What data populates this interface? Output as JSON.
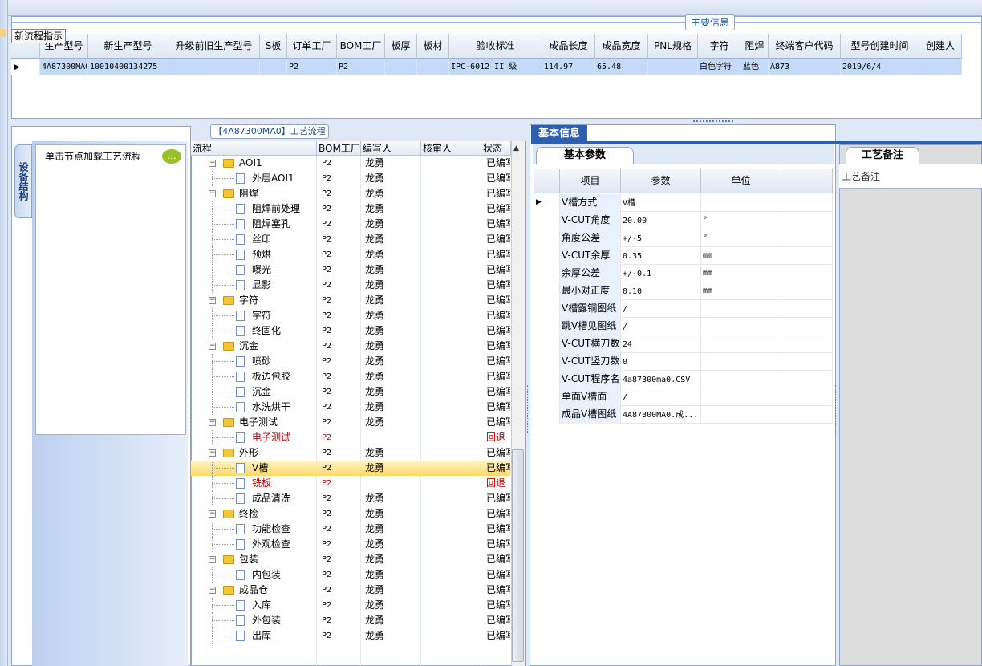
{
  "main_panel": {
    "group_title": "主要信息",
    "hint_label": "新流程指示",
    "columns": [
      "生产型号",
      "新生产型号",
      "升级前旧生产型号",
      "S板",
      "订单工厂",
      "BOM工厂",
      "板厚",
      "板材",
      "验收标准",
      "成品长度",
      "成品宽度",
      "PNL规格",
      "字符",
      "阻焊",
      "终端客户代码",
      "型号创建时间",
      "创建人"
    ],
    "row": [
      "4A87300MA0",
      "10010400134275",
      "",
      "",
      "P2",
      "P2",
      "",
      "",
      "IPC-6012 II 级",
      "114.97",
      "65.48",
      "",
      "白色字符",
      "蓝色",
      "A873",
      "2019/6/4",
      ""
    ]
  },
  "left_panel": {
    "vertical_tab": "设备结构",
    "node_hint": "单击节点加载工艺流程"
  },
  "process_panel": {
    "title": "【4A87300MA0】工艺流程",
    "columns": [
      "流程",
      "BOM工厂",
      "编写人",
      "核审人",
      "状态"
    ],
    "rows": [
      {
        "level": 1,
        "type": "folder",
        "name": "AOI1",
        "bom": "P2",
        "author": "龙勇",
        "status": "已编写",
        "red": false,
        "selected": false
      },
      {
        "level": 2,
        "type": "doc",
        "name": "外层AOI1",
        "bom": "P2",
        "author": "龙勇",
        "status": "已编写",
        "red": false,
        "selected": false
      },
      {
        "level": 1,
        "type": "folder",
        "name": "阻焊",
        "bom": "P2",
        "author": "龙勇",
        "status": "已编写",
        "red": false,
        "selected": false
      },
      {
        "level": 2,
        "type": "doc",
        "name": "阻焊前处理",
        "bom": "P2",
        "author": "龙勇",
        "status": "已编写",
        "red": false,
        "selected": false
      },
      {
        "level": 2,
        "type": "doc",
        "name": "阻焊塞孔",
        "bom": "P2",
        "author": "龙勇",
        "status": "已编写",
        "red": false,
        "selected": false
      },
      {
        "level": 2,
        "type": "doc",
        "name": "丝印",
        "bom": "P2",
        "author": "龙勇",
        "status": "已编写",
        "red": false,
        "selected": false
      },
      {
        "level": 2,
        "type": "doc",
        "name": "预烘",
        "bom": "P2",
        "author": "龙勇",
        "status": "已编写",
        "red": false,
        "selected": false
      },
      {
        "level": 2,
        "type": "doc",
        "name": "曝光",
        "bom": "P2",
        "author": "龙勇",
        "status": "已编写",
        "red": false,
        "selected": false
      },
      {
        "level": 2,
        "type": "doc",
        "name": "显影",
        "bom": "P2",
        "author": "龙勇",
        "status": "已编写",
        "red": false,
        "selected": false
      },
      {
        "level": 1,
        "type": "folder",
        "name": "字符",
        "bom": "P2",
        "author": "龙勇",
        "status": "已编写",
        "red": false,
        "selected": false
      },
      {
        "level": 2,
        "type": "doc",
        "name": "字符",
        "bom": "P2",
        "author": "龙勇",
        "status": "已编写",
        "red": false,
        "selected": false
      },
      {
        "level": 2,
        "type": "doc",
        "name": "终固化",
        "bom": "P2",
        "author": "龙勇",
        "status": "已编写",
        "red": false,
        "selected": false
      },
      {
        "level": 1,
        "type": "folder",
        "name": "沉金",
        "bom": "P2",
        "author": "龙勇",
        "status": "已编写",
        "red": false,
        "selected": false
      },
      {
        "level": 2,
        "type": "doc",
        "name": "喷砂",
        "bom": "P2",
        "author": "龙勇",
        "status": "已编写",
        "red": false,
        "selected": false
      },
      {
        "level": 2,
        "type": "doc",
        "name": "板边包胶",
        "bom": "P2",
        "author": "龙勇",
        "status": "已编写",
        "red": false,
        "selected": false
      },
      {
        "level": 2,
        "type": "doc",
        "name": "沉金",
        "bom": "P2",
        "author": "龙勇",
        "status": "已编写",
        "red": false,
        "selected": false
      },
      {
        "level": 2,
        "type": "doc",
        "name": "水洗烘干",
        "bom": "P2",
        "author": "龙勇",
        "status": "已编写",
        "red": false,
        "selected": false
      },
      {
        "level": 1,
        "type": "folder",
        "name": "电子测试",
        "bom": "P2",
        "author": "龙勇",
        "status": "已编写",
        "red": false,
        "selected": false
      },
      {
        "level": 2,
        "type": "doc",
        "name": "电子测试",
        "bom": "P2",
        "author": "",
        "status": "回退",
        "red": true,
        "selected": false
      },
      {
        "level": 1,
        "type": "folder",
        "name": "外形",
        "bom": "P2",
        "author": "龙勇",
        "status": "已编写",
        "red": false,
        "selected": false
      },
      {
        "level": 2,
        "type": "doc",
        "name": "V槽",
        "bom": "P2",
        "author": "龙勇",
        "status": "已编写",
        "red": false,
        "selected": true
      },
      {
        "level": 2,
        "type": "doc",
        "name": "铣板",
        "bom": "P2",
        "author": "",
        "status": "回退",
        "red": true,
        "selected": false
      },
      {
        "level": 2,
        "type": "doc",
        "name": "成品清洗",
        "bom": "P2",
        "author": "龙勇",
        "status": "已编写",
        "red": false,
        "selected": false
      },
      {
        "level": 1,
        "type": "folder",
        "name": "终检",
        "bom": "P2",
        "author": "龙勇",
        "status": "已编写",
        "red": false,
        "selected": false
      },
      {
        "level": 2,
        "type": "doc",
        "name": "功能检查",
        "bom": "P2",
        "author": "龙勇",
        "status": "已编写",
        "red": false,
        "selected": false
      },
      {
        "level": 2,
        "type": "doc",
        "name": "外观检查",
        "bom": "P2",
        "author": "龙勇",
        "status": "已编写",
        "red": false,
        "selected": false
      },
      {
        "level": 1,
        "type": "folder",
        "name": "包装",
        "bom": "P2",
        "author": "龙勇",
        "status": "已编写",
        "red": false,
        "selected": false
      },
      {
        "level": 2,
        "type": "doc",
        "name": "内包装",
        "bom": "P2",
        "author": "龙勇",
        "status": "已编写",
        "red": false,
        "selected": false
      },
      {
        "level": 1,
        "type": "folder",
        "name": "成品仓",
        "bom": "P2",
        "author": "龙勇",
        "status": "已编写",
        "red": false,
        "selected": false
      },
      {
        "level": 2,
        "type": "doc",
        "name": "入库",
        "bom": "P2",
        "author": "龙勇",
        "status": "已编写",
        "red": false,
        "selected": false
      },
      {
        "level": 2,
        "type": "doc",
        "name": "外包装",
        "bom": "P2",
        "author": "龙勇",
        "status": "已编写",
        "red": false,
        "selected": false
      },
      {
        "level": 2,
        "type": "doc",
        "name": "出库",
        "bom": "P2",
        "author": "龙勇",
        "status": "已编写",
        "red": false,
        "selected": false
      }
    ]
  },
  "basic_info": {
    "tab": "基本信息",
    "subtab": "基本参数",
    "columns": [
      "项目",
      "参数",
      "单位"
    ],
    "rows": [
      {
        "item": "V槽方式",
        "value": "V槽",
        "unit": ""
      },
      {
        "item": "V-CUT角度",
        "value": "20.00",
        "unit": "°"
      },
      {
        "item": "角度公差",
        "value": "+/-5",
        "unit": "°"
      },
      {
        "item": "V-CUT余厚",
        "value": "0.35",
        "unit": "mm"
      },
      {
        "item": "余厚公差",
        "value": "+/-0.1",
        "unit": "mm"
      },
      {
        "item": "最小对正度",
        "value": "0.10",
        "unit": "mm"
      },
      {
        "item": "V槽露铜图纸",
        "value": "/",
        "unit": ""
      },
      {
        "item": "跳V槽见图纸",
        "value": "/",
        "unit": ""
      },
      {
        "item": "V-CUT横刀数",
        "value": "24",
        "unit": ""
      },
      {
        "item": "V-CUT竖刀数",
        "value": "0",
        "unit": ""
      },
      {
        "item": "V-CUT程序名",
        "value": "4a87300ma0.CSV",
        "unit": ""
      },
      {
        "item": "单面V槽面",
        "value": "/",
        "unit": ""
      },
      {
        "item": "成品V槽图纸",
        "value": "4A87300MA0.成...",
        "unit": ""
      }
    ]
  },
  "remark": {
    "tab": "工艺备注",
    "header": "工艺备注"
  }
}
